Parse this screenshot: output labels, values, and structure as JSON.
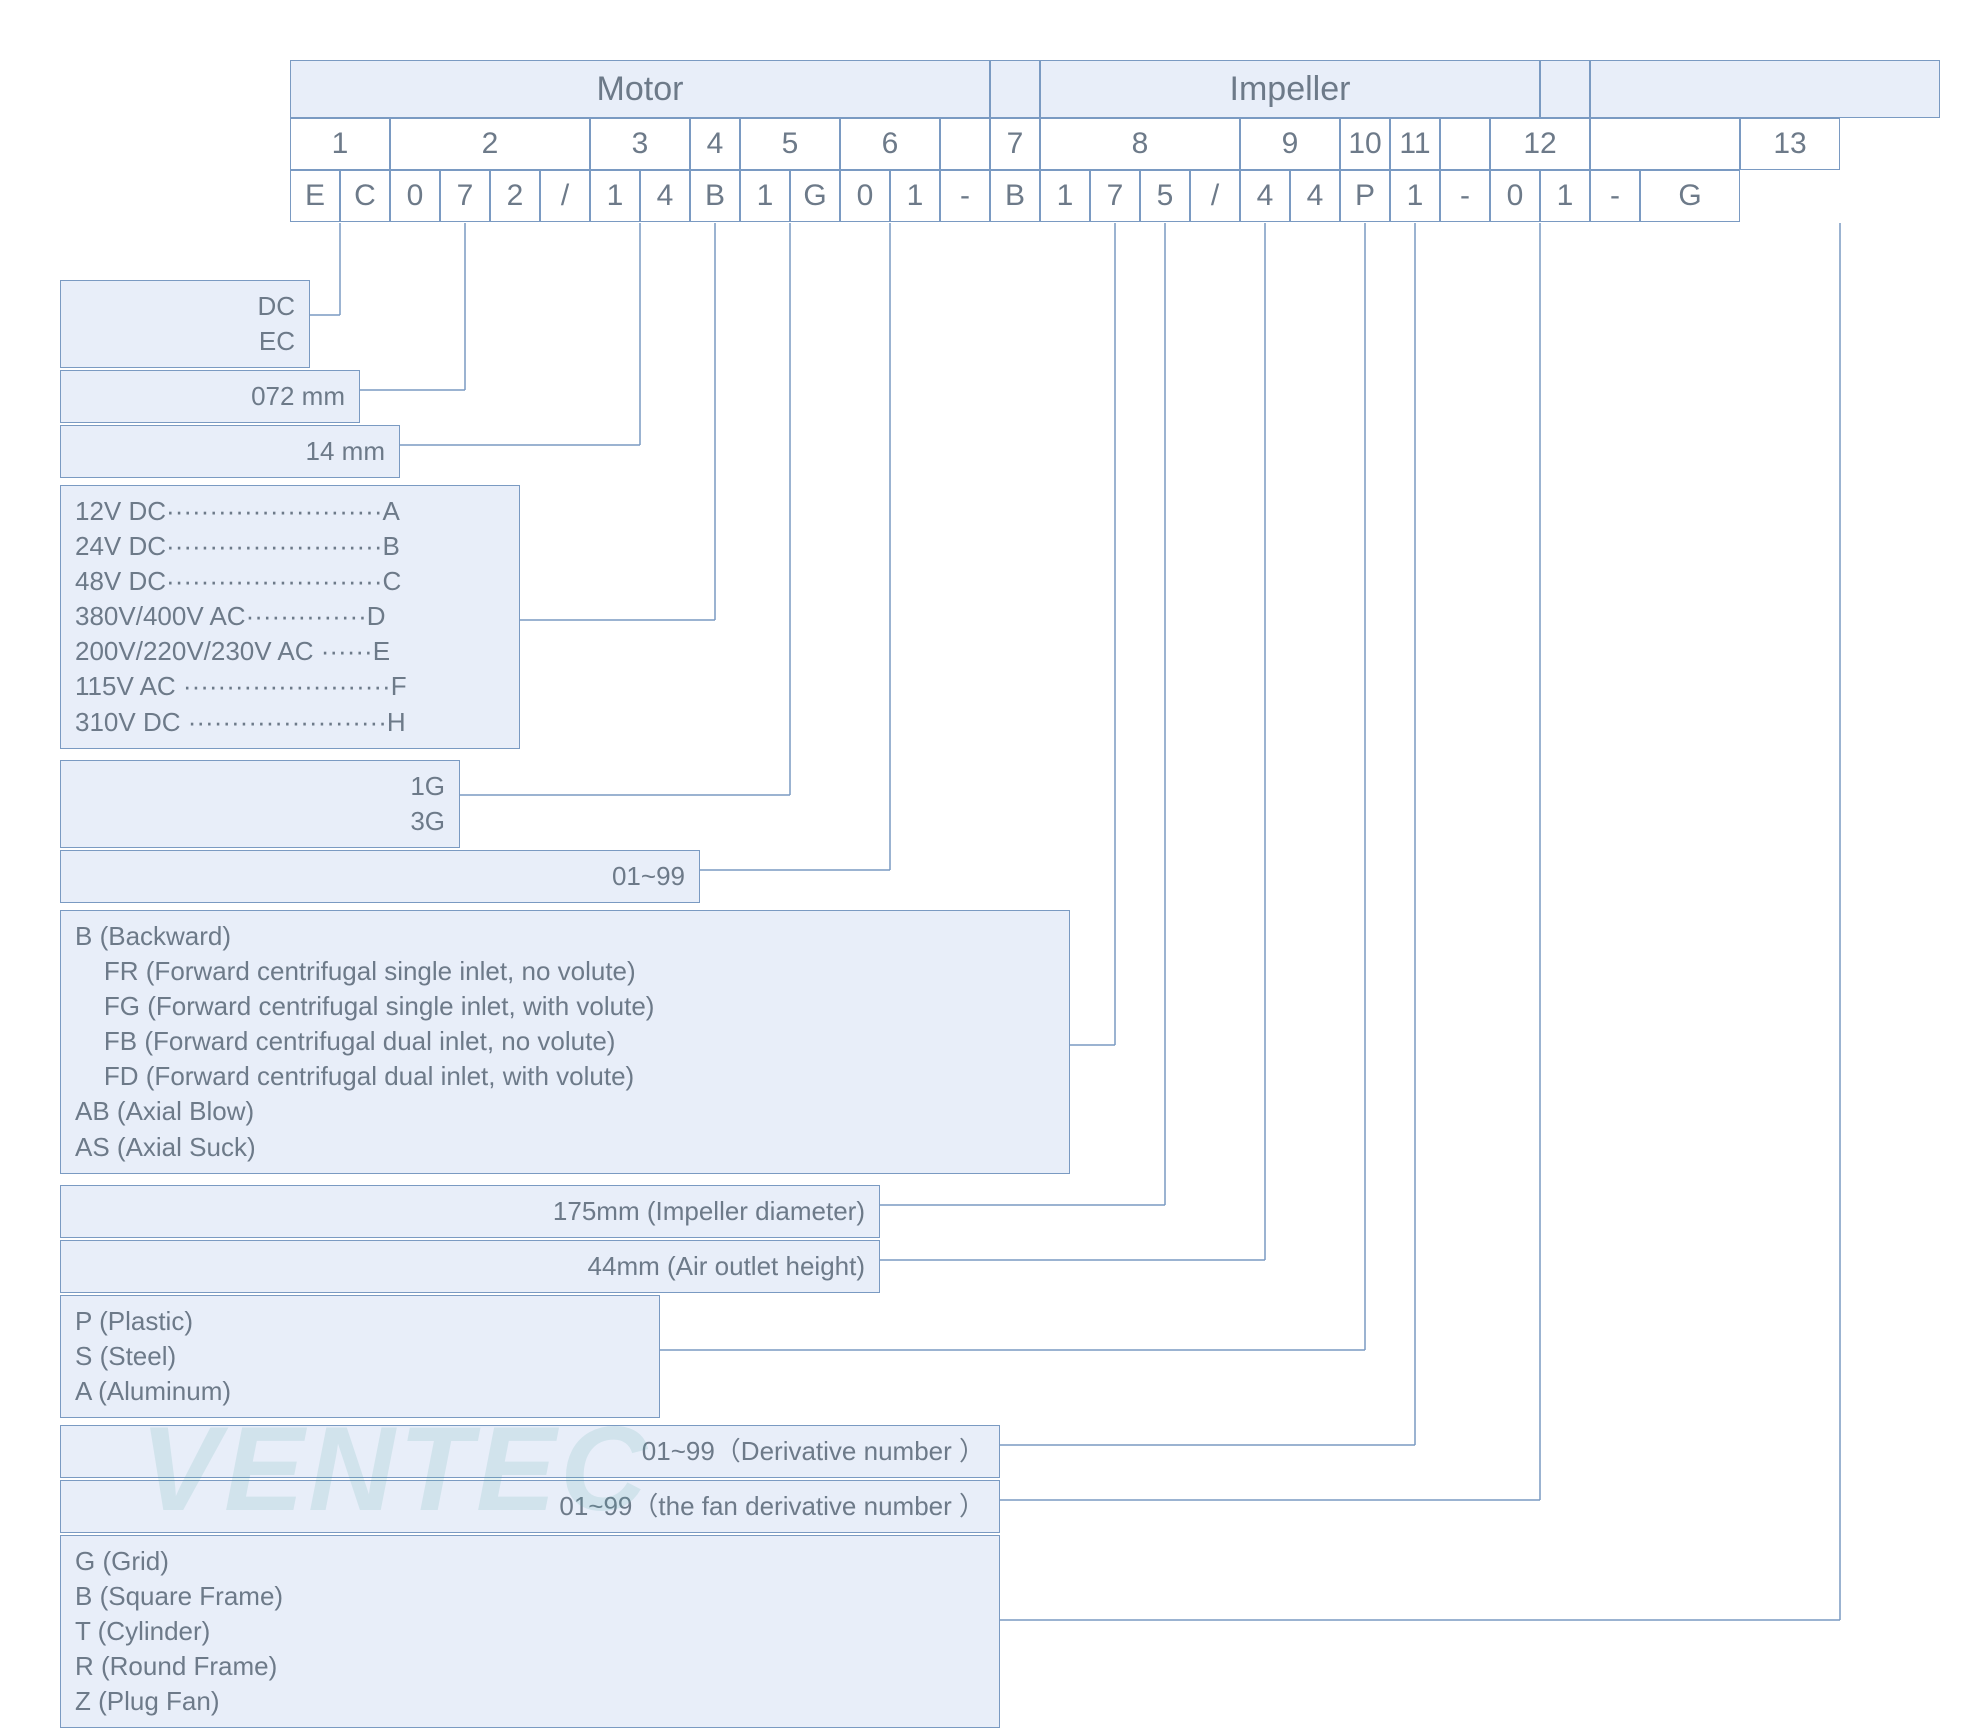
{
  "headers": {
    "motor": "Motor",
    "impeller": "Impeller"
  },
  "positions": [
    "1",
    "2",
    "3",
    "4",
    "5",
    "6",
    "7",
    "8",
    "9",
    "10",
    "11",
    "12",
    "13"
  ],
  "code_cells": [
    "E",
    "C",
    "0",
    "7",
    "2",
    "/",
    "1",
    "4",
    "B",
    "1",
    "G",
    "0",
    "1",
    "-",
    "B",
    "1",
    "7",
    "5",
    "/",
    "4",
    "4",
    "P",
    "1",
    "-",
    "0",
    "1",
    "-",
    "G"
  ],
  "legends": {
    "l1": "DC\nEC",
    "l2": "072 mm",
    "l3": "14 mm",
    "l4": "12V DC·························A\n24V DC·························B\n48V DC·························C\n380V/400V AC··············D\n200V/220V/230V AC ······E\n115V AC ························F\n310V DC ·······················H",
    "l5": "1G\n3G",
    "l6": "01~99",
    "l7": "B (Backward)\n    FR (Forward centrifugal single inlet, no volute)\n    FG (Forward centrifugal single inlet, with volute)\n    FB (Forward centrifugal dual inlet, no volute)\n    FD (Forward centrifugal dual inlet, with volute)\nAB (Axial Blow)\nAS (Axial Suck)",
    "l8": "175mm (Impeller diameter)",
    "l9": "44mm (Air outlet height)",
    "l10": "P (Plastic)\nS (Steel)\nA (Aluminum)",
    "l11": "01~99（Derivative number ）",
    "l12": "01~99（the fan derivative number ）",
    "l13": "G (Grid)\nB (Square Frame)\nT (Cylinder)\nR (Round Frame)\nZ (Plug Fan)"
  },
  "watermark": "VENTEC"
}
